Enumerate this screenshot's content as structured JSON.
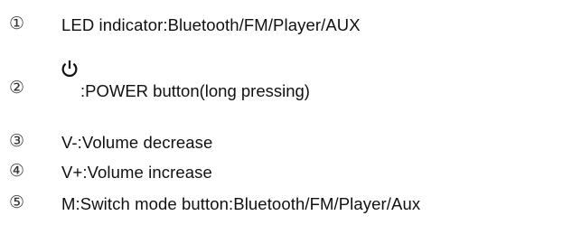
{
  "items": [
    {
      "number": "①",
      "text": "LED indicator:Bluetooth/FM/Player/AUX"
    },
    {
      "number": "②",
      "icon": "power-icon",
      "text": ":POWER button(long pressing)"
    },
    {
      "number": "③",
      "text": "V-:Volume decrease"
    },
    {
      "number": "④",
      "text": "V+:Volume increase"
    },
    {
      "number": "⑤",
      "text": "M:Switch mode button:Bluetooth/FM/Player/Aux"
    }
  ]
}
